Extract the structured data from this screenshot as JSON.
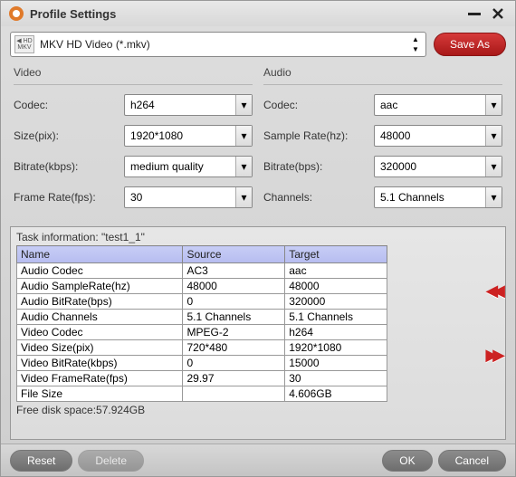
{
  "window": {
    "title": "Profile Settings"
  },
  "profile": {
    "selected": "MKV HD Video (*.mkv)",
    "fmt_top": "◀ HD",
    "fmt_bot": "MKV"
  },
  "buttons": {
    "save_as": "Save As",
    "reset": "Reset",
    "delete": "Delete",
    "ok": "OK",
    "cancel": "Cancel"
  },
  "video": {
    "heading": "Video",
    "codec_label": "Codec:",
    "codec": "h264",
    "size_label": "Size(pix):",
    "size": "1920*1080",
    "bitrate_label": "Bitrate(kbps):",
    "bitrate": "medium quality",
    "framerate_label": "Frame Rate(fps):",
    "framerate": "30"
  },
  "audio": {
    "heading": "Audio",
    "codec_label": "Codec:",
    "codec": "aac",
    "samplerate_label": "Sample Rate(hz):",
    "samplerate": "48000",
    "bitrate_label": "Bitrate(bps):",
    "bitrate": "320000",
    "channels_label": "Channels:",
    "channels": "5.1 Channels"
  },
  "task": {
    "title": "Task information: \"test1_1\"",
    "headers": [
      "Name",
      "Source",
      "Target"
    ],
    "rows": [
      [
        "Audio Codec",
        "AC3",
        "aac"
      ],
      [
        "Audio SampleRate(hz)",
        "48000",
        "48000"
      ],
      [
        "Audio BitRate(bps)",
        "0",
        "320000"
      ],
      [
        "Audio Channels",
        "5.1 Channels",
        "5.1 Channels"
      ],
      [
        "Video Codec",
        "MPEG-2",
        "h264"
      ],
      [
        "Video Size(pix)",
        "720*480",
        "1920*1080"
      ],
      [
        "Video BitRate(kbps)",
        "0",
        "15000"
      ],
      [
        "Video FrameRate(fps)",
        "29.97",
        "30"
      ],
      [
        "File Size",
        "",
        "4.606GB"
      ]
    ],
    "free_disk": "Free disk space:57.924GB"
  }
}
